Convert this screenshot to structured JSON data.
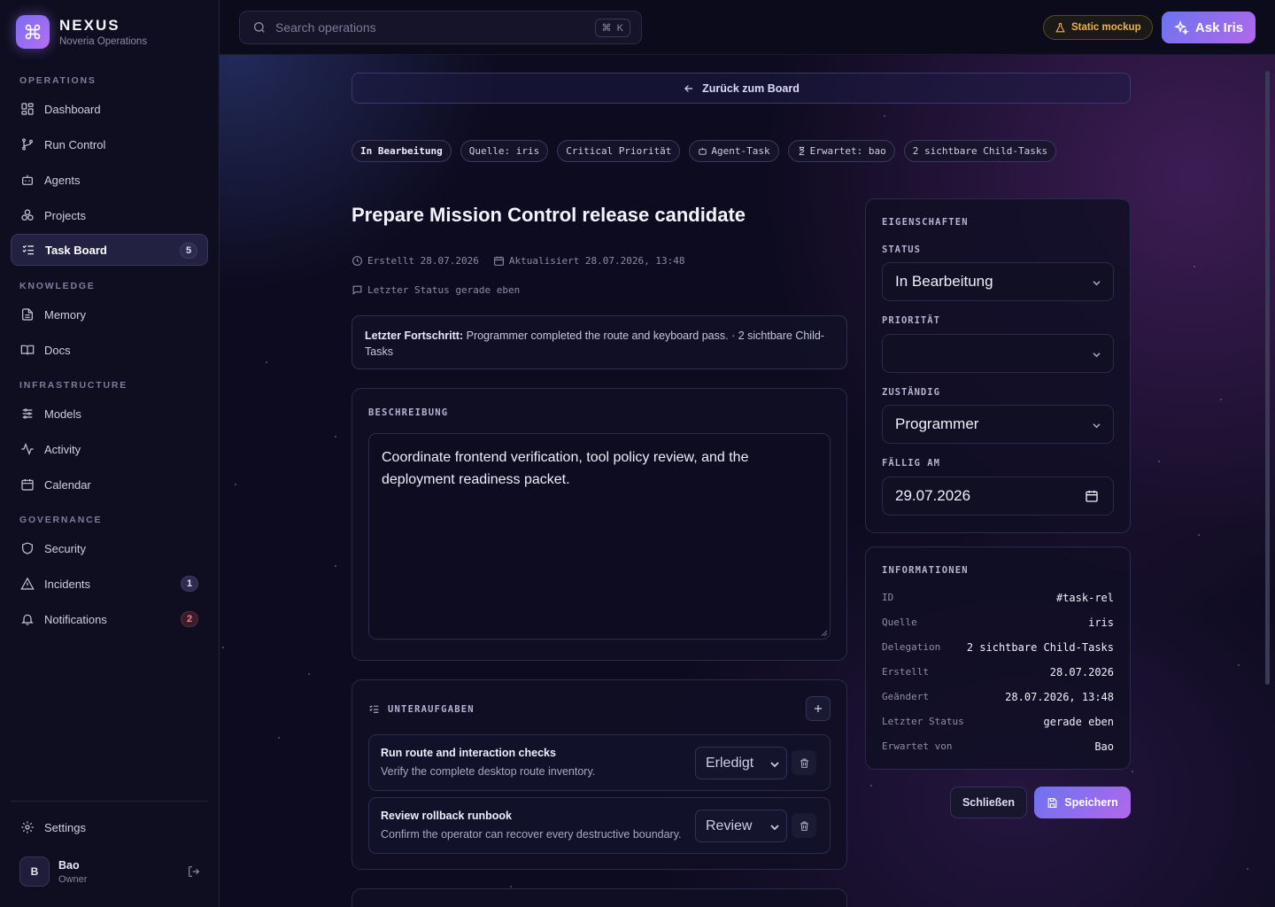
{
  "brand": {
    "title": "NEXUS",
    "subtitle": "Noveria Operations"
  },
  "sidebar": {
    "sections": [
      {
        "label": "OPERATIONS",
        "items": [
          {
            "label": "Dashboard",
            "icon": "dashboard-icon"
          },
          {
            "label": "Run Control",
            "icon": "branch-icon"
          },
          {
            "label": "Agents",
            "icon": "bot-icon"
          },
          {
            "label": "Projects",
            "icon": "projects-icon"
          },
          {
            "label": "Task Board",
            "icon": "checklist-icon",
            "badge": "5",
            "active": true
          }
        ]
      },
      {
        "label": "KNOWLEDGE",
        "items": [
          {
            "label": "Memory",
            "icon": "document-icon"
          },
          {
            "label": "Docs",
            "icon": "book-icon"
          }
        ]
      },
      {
        "label": "INFRASTRUCTURE",
        "items": [
          {
            "label": "Models",
            "icon": "sliders-icon"
          },
          {
            "label": "Activity",
            "icon": "activity-icon"
          },
          {
            "label": "Calendar",
            "icon": "calendar-icon"
          }
        ]
      },
      {
        "label": "GOVERNANCE",
        "items": [
          {
            "label": "Security",
            "icon": "shield-icon"
          },
          {
            "label": "Incidents",
            "icon": "warning-icon",
            "badge": "1"
          },
          {
            "label": "Notifications",
            "icon": "bell-icon",
            "badge": "2"
          }
        ]
      }
    ],
    "settings_label": "Settings",
    "user": {
      "initial": "B",
      "name": "Bao",
      "role": "Owner"
    }
  },
  "topbar": {
    "search_placeholder": "Search operations",
    "shortcut_symbol": "⌘",
    "shortcut_key": "K",
    "mock_label": "Static mockup",
    "ask_label": "Ask Iris"
  },
  "task": {
    "back_label": "Zurück zum Board",
    "chips": [
      "In Bearbeitung",
      "Quelle: iris",
      "Critical Priorität",
      "Agent-Task",
      "Erwartet: bao",
      "2 sichtbare Child-Tasks"
    ],
    "title": "Prepare Mission Control release candidate",
    "created": "Erstellt 28.07.2026",
    "updated": "Aktualisiert 28.07.2026, 13:48",
    "last_status": "Letzter Status gerade eben",
    "progress_label": "Letzter Fortschritt:",
    "progress_text": "Programmer completed the route and keyboard pass. · 2 sichtbare Child-Tasks",
    "description_label": "BESCHREIBUNG",
    "description": "Coordinate frontend verification, tool policy review, and the deployment readiness packet.",
    "subtasks_label": "UNTERAUFGABEN",
    "subtasks": [
      {
        "title": "Run route and interaction checks",
        "desc": "Verify the complete desktop route inventory.",
        "status": "Erledigt"
      },
      {
        "title": "Review rollback runbook",
        "desc": "Confirm the operator can recover every destructive boundary.",
        "status": "Review"
      }
    ]
  },
  "properties": {
    "label": "EIGENSCHAFTEN",
    "status_label": "STATUS",
    "status_value": "In Bearbeitung",
    "priority_label": "PRIORITÄT",
    "priority_value": "",
    "assignee_label": "ZUSTÄNDIG",
    "assignee_value": "Programmer",
    "due_label": "FÄLLIG AM",
    "due_value": "29.07.2026"
  },
  "information": {
    "label": "INFORMATIONEN",
    "rows": [
      {
        "key": "ID",
        "value": "#task-rel"
      },
      {
        "key": "Quelle",
        "value": "iris"
      },
      {
        "key": "Delegation",
        "value": "2 sichtbare Child-Tasks"
      },
      {
        "key": "Erstellt",
        "value": "28.07.2026"
      },
      {
        "key": "Geändert",
        "value": "28.07.2026, 13:48"
      },
      {
        "key": "Letzter Status",
        "value": "gerade eben"
      },
      {
        "key": "Erwartet von",
        "value": "Bao"
      }
    ]
  },
  "actions": {
    "close_label": "Schließen",
    "save_label": "Speichern"
  }
}
